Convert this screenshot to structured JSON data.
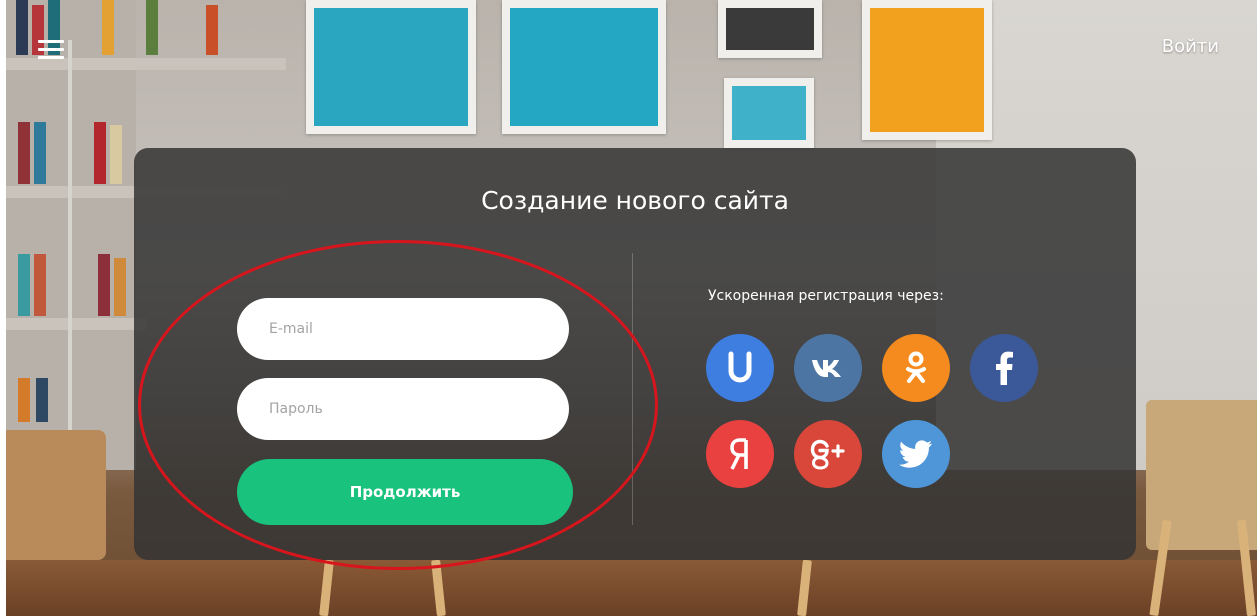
{
  "header": {
    "menu_icon": "hamburger-menu-icon",
    "login_label": "Войти"
  },
  "modal": {
    "title": "Создание нового сайта",
    "email_placeholder": "E-mail",
    "password_placeholder": "Пароль",
    "submit_label": "Продолжить",
    "social_title": "Ускоренная регистрация через:",
    "social": [
      {
        "icon": "ucoz-icon",
        "label": "U",
        "color": "#3d7ee0"
      },
      {
        "icon": "vk-icon",
        "label": "vk",
        "color": "#4c75a3"
      },
      {
        "icon": "odnoklassniki-icon",
        "label": "ok",
        "color": "#f58b1f"
      },
      {
        "icon": "facebook-icon",
        "label": "f",
        "color": "#3b5998"
      },
      {
        "icon": "yandex-icon",
        "label": "Я",
        "color": "#e8413f"
      },
      {
        "icon": "google-plus-icon",
        "label": "g+",
        "color": "#d9463a"
      },
      {
        "icon": "twitter-icon",
        "label": "twitter",
        "color": "#4f96d8"
      }
    ]
  },
  "colors": {
    "accent_button": "#19c27d",
    "highlight": "#d8151c"
  }
}
